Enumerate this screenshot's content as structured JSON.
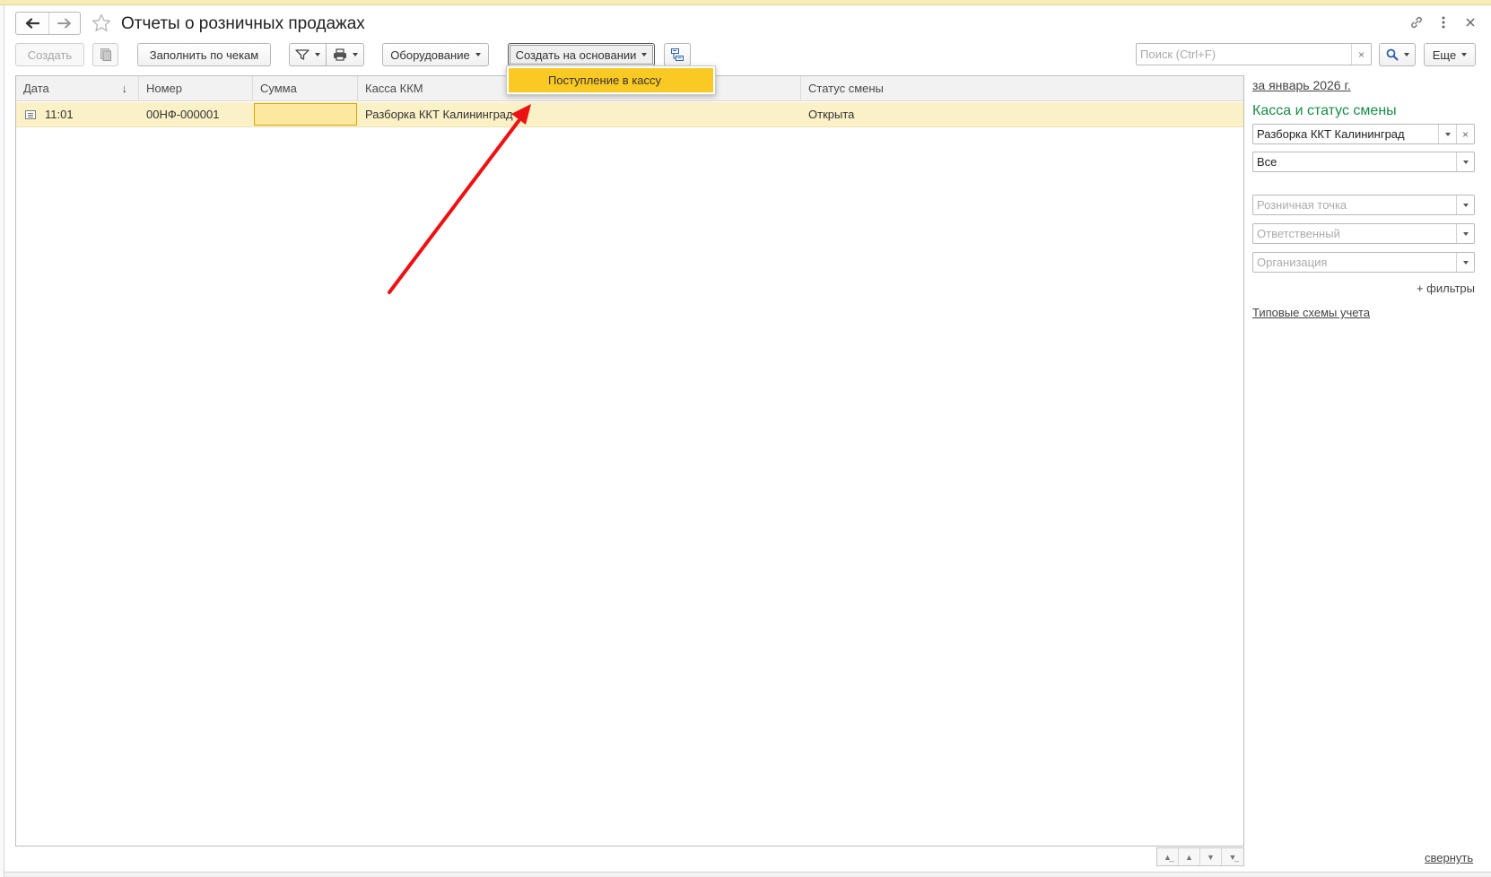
{
  "window": {
    "title": "Отчеты о розничных продажах",
    "link_icon": "link-icon",
    "menu_icon": "more-vertical-icon",
    "close_icon": "close-icon"
  },
  "toolbar": {
    "create_label": "Создать",
    "fill_by_receipts_label": "Заполнить по чекам",
    "equipment_label": "Оборудование",
    "create_based_on_label": "Создать на основании",
    "more_label": "Еще",
    "search_placeholder": "Поиск (Ctrl+F)",
    "search_clear": "×"
  },
  "dropdown": {
    "items": [
      {
        "label": "Поступление в кассу"
      }
    ]
  },
  "table": {
    "columns": [
      "Дата",
      "Номер",
      "Сумма",
      "Касса ККМ",
      "Статус смены"
    ],
    "sort_indicator": "↓",
    "rows": [
      {
        "date": "11:01",
        "number": "00НФ-000001",
        "sum": "",
        "kkm": "Разборка ККТ Калининград",
        "status": "Открыта"
      }
    ]
  },
  "filters": {
    "period_link": "за январь 2026 г.",
    "section_title": "Касса и статус смены",
    "kkm_value": "Разборка ККТ Калининград",
    "status_value": "Все",
    "retail_point_placeholder": "Розничная точка",
    "responsible_placeholder": "Ответственный",
    "organization_placeholder": "Организация",
    "add_filters": "+ фильтры",
    "schemes_link": "Типовые схемы учета",
    "collapse_link": "свернуть"
  },
  "colors": {
    "accent_yellow": "#fbc923",
    "row_highlight": "#fbf1c7",
    "section_green": "#1a8b4b",
    "annotation_red": "#ee1111"
  }
}
